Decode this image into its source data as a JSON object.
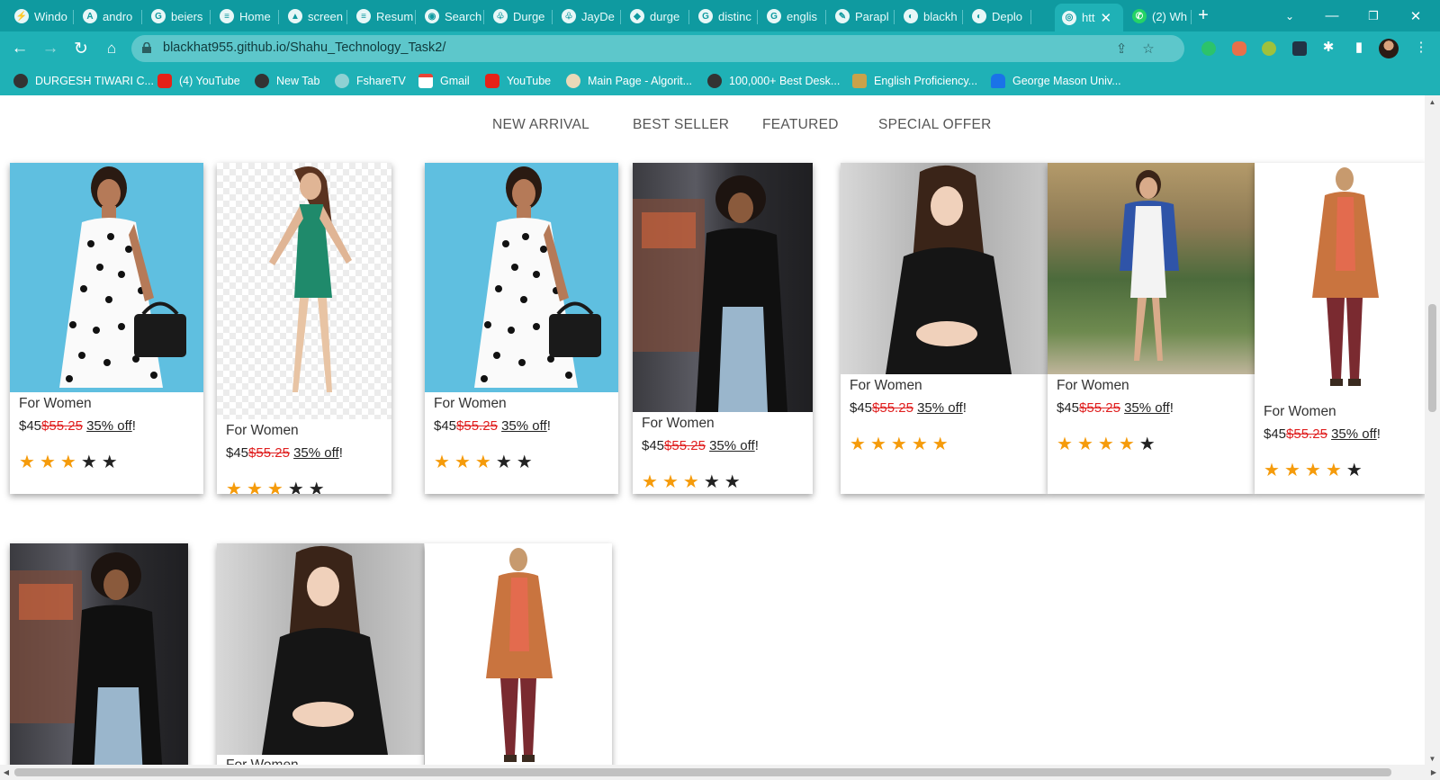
{
  "browser": {
    "tabs": [
      {
        "title": "Windo"
      },
      {
        "title": "andro"
      },
      {
        "title": "beiers"
      },
      {
        "title": "Home"
      },
      {
        "title": "screen"
      },
      {
        "title": "Resum"
      },
      {
        "title": "Search"
      },
      {
        "title": "Durge"
      },
      {
        "title": "JayDe"
      },
      {
        "title": "durge"
      },
      {
        "title": "distinc"
      },
      {
        "title": "englis"
      },
      {
        "title": "Parapl"
      },
      {
        "title": "blackh"
      },
      {
        "title": "Deplo"
      },
      {
        "title": "htt"
      },
      {
        "title": "(2) Wh"
      }
    ],
    "new_tab_icon": "plus-icon",
    "url": "blackhat955.github.io/Shahu_Technology_Task2/",
    "bookmarks": [
      {
        "label": "DURGESH TIWARI C..."
      },
      {
        "label": "(4) YouTube"
      },
      {
        "label": "New Tab"
      },
      {
        "label": "FshareTV"
      },
      {
        "label": "Gmail"
      },
      {
        "label": "YouTube"
      },
      {
        "label": "Main Page - Algorit..."
      },
      {
        "label": "100,000+ Best Desk..."
      },
      {
        "label": "English Proficiency..."
      },
      {
        "label": "George Mason Univ..."
      }
    ],
    "colors": {
      "tabstrip": "#0f9aa0",
      "toolbar": "#1fb1b6"
    }
  },
  "page": {
    "nav": [
      "NEW ARRIVAL",
      "BEST SELLER",
      "FEATURED",
      "SPECIAL OFFER"
    ],
    "products": [
      {
        "label": "For Women",
        "price": "$45",
        "old_price": "$55.25",
        "discount": "35% off",
        "suffix": "!",
        "rating": 3
      },
      {
        "label": "For Women",
        "price": "$45",
        "old_price": "$55.25",
        "discount": "35% off",
        "suffix": "!",
        "rating": 3
      },
      {
        "label": "For Women",
        "price": "$45",
        "old_price": "$55.25",
        "discount": "35% off",
        "suffix": "!",
        "rating": 3
      },
      {
        "label": "For Women",
        "price": "$45",
        "old_price": "$55.25",
        "discount": "35% off",
        "suffix": "!",
        "rating": 3
      },
      {
        "label": "For Women",
        "price": "$45",
        "old_price": "$55.25",
        "discount": "35% off",
        "suffix": "!",
        "rating": 5
      },
      {
        "label": "For Women",
        "price": "$45",
        "old_price": "$55.25",
        "discount": "35% off",
        "suffix": "!",
        "rating": 4
      },
      {
        "label": "For Women",
        "price": "$45",
        "old_price": "$55.25",
        "discount": "35% off",
        "suffix": "!",
        "rating": 4
      },
      {
        "label": "For Women"
      }
    ],
    "colors": {
      "star_filled": "#f59b0b",
      "star_empty": "#222222",
      "old_price": "#e02020"
    }
  }
}
